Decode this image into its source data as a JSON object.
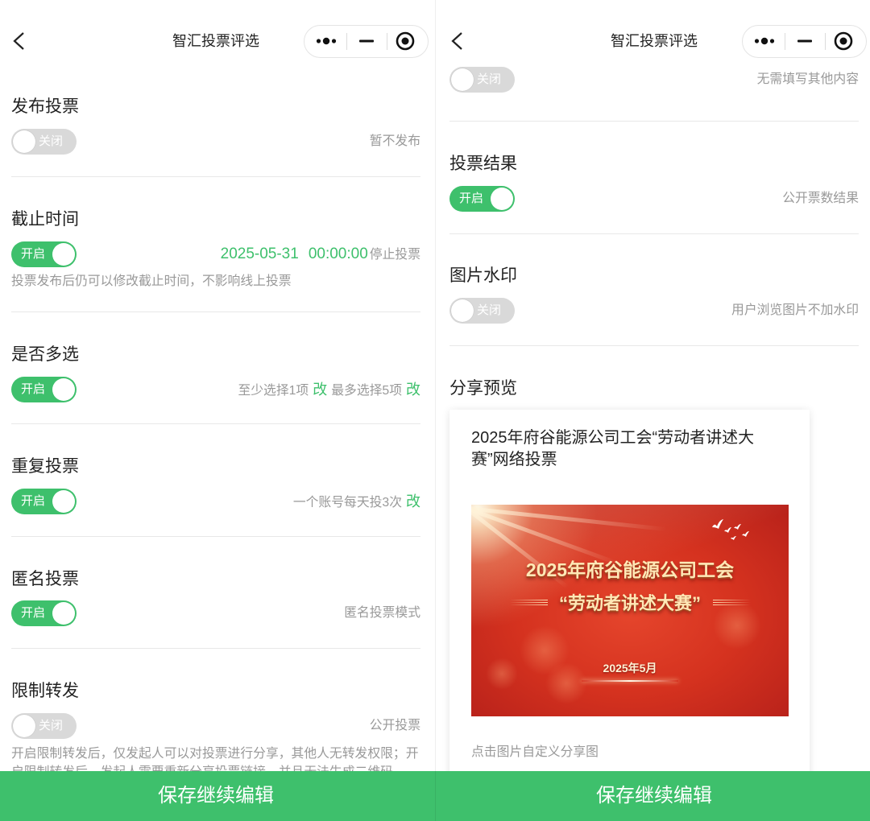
{
  "colors": {
    "accent": "#3ec06c",
    "toggle_off": "#d9d9d9",
    "text": "#222222",
    "muted": "#999999",
    "divider": "#e8e8e8",
    "poster_red": "#d5321f",
    "poster_gold": "#ffe8b6"
  },
  "icons": {
    "back": "chevron-left-icon",
    "more": "more-dots-icon",
    "minimize": "minimize-icon",
    "close": "close-target-icon",
    "poster_birds": "birds-icon"
  },
  "left": {
    "header": {
      "title": "智汇投票评选"
    },
    "publish": {
      "title": "发布投票",
      "toggle_on": false,
      "toggle_label": "关闭",
      "status": "暂不发布"
    },
    "deadline": {
      "title": "截止时间",
      "toggle_on": true,
      "toggle_label": "开启",
      "date": "2025-05-31",
      "time": "00:00:00",
      "action": "停止投票",
      "note": "投票发布后仍可以修改截止时间，不影响线上投票"
    },
    "multi_select": {
      "title": "是否多选",
      "toggle_on": true,
      "toggle_label": "开启",
      "min_text": "至少选择1项",
      "min_edit": "改",
      "max_text": "最多选择5项",
      "max_edit": "改"
    },
    "repeat_vote": {
      "title": "重复投票",
      "toggle_on": true,
      "toggle_label": "开启",
      "rule": "一个账号每天投3次",
      "edit": "改"
    },
    "anonymous": {
      "title": "匿名投票",
      "toggle_on": true,
      "toggle_label": "开启",
      "status": "匿名投票模式"
    },
    "restrict_share": {
      "title": "限制转发",
      "toggle_on": false,
      "toggle_label": "关闭",
      "status": "公开投票",
      "note": "开启限制转发后，仅发起人可以对投票进行分享，其他人无转发权限；开启限制转发后，发起人需要重新分享投票链接，并且无法生成二维码"
    },
    "save_button": "保存继续编辑"
  },
  "right": {
    "header": {
      "title": "智汇投票评选"
    },
    "previous_option": {
      "toggle_on": false,
      "toggle_label": "关闭",
      "status": "无需填写其他内容"
    },
    "vote_result": {
      "title": "投票结果",
      "toggle_on": true,
      "toggle_label": "开启",
      "status": "公开票数结果"
    },
    "watermark": {
      "title": "图片水印",
      "toggle_on": false,
      "toggle_label": "关闭",
      "status": "用户浏览图片不加水印"
    },
    "share_preview": {
      "title": "分享预览",
      "card_title": "2025年府谷能源公司工会“劳动者讲述大赛”网络投票",
      "poster": {
        "line1": "2025年府谷能源公司工会",
        "line2": "“劳动者讲述大赛”",
        "date": "2025年5月"
      },
      "hint": "点击图片自定义分享图"
    },
    "save_button": "保存继续编辑"
  }
}
